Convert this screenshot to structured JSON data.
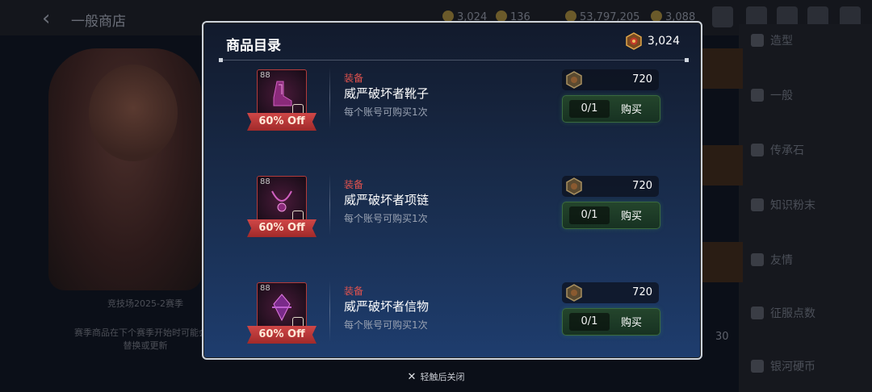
{
  "background": {
    "title": "一般商店",
    "resources": [
      "3,024",
      "136",
      "53,797,205",
      "3,088"
    ],
    "left_caption": "竞技场2025-2赛季",
    "left_note": "赛季商品在下个赛季开始时可能会被替换或更新",
    "side_menu": [
      "造型",
      "一般",
      "传承石",
      "知识粉末",
      "友情",
      "征服点数",
      "银河硬币"
    ],
    "side_value": "30"
  },
  "modal": {
    "title": "商品目录",
    "currency_value": "3,024",
    "items": [
      {
        "level": "88",
        "discount": "60% Off",
        "category": "装备",
        "name": "威严破坏者靴子",
        "limit": "每个账号可购买1次",
        "price": "720",
        "count": "0/1",
        "buy_label": "购买"
      },
      {
        "level": "88",
        "discount": "60% Off",
        "category": "装备",
        "name": "威严破坏者项链",
        "limit": "每个账号可购买1次",
        "price": "720",
        "count": "0/1",
        "buy_label": "购买"
      },
      {
        "level": "88",
        "discount": "60% Off",
        "category": "装备",
        "name": "威严破坏者信物",
        "limit": "每个账号可购买1次",
        "price": "720",
        "count": "0/1",
        "buy_label": "购买"
      }
    ]
  },
  "close_hint": "轻触后关闭",
  "icons": {
    "currency": "arena-medal-icon",
    "close": "close-x-icon",
    "back": "back-arrow-icon"
  },
  "colors": {
    "accent_red": "#e4534e",
    "buy_green": "#24452c",
    "modal_border": "#cdd3db"
  }
}
